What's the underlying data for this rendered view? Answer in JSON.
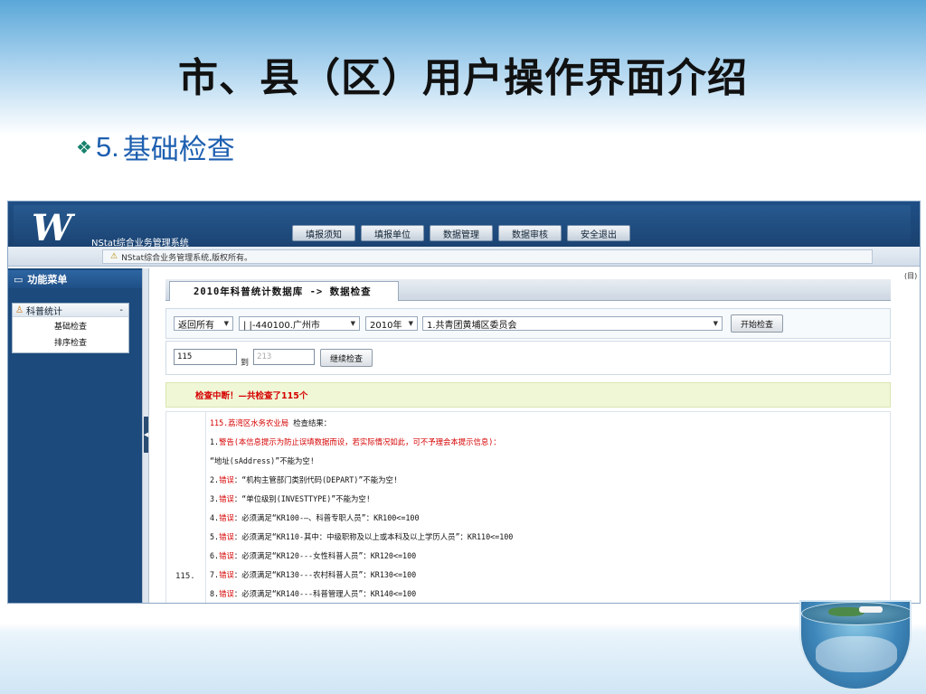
{
  "slide": {
    "title": "市、县（区）用户操作界面介绍",
    "bullet_number": "5.",
    "bullet_text": "基础检查"
  },
  "app": {
    "logo": "W",
    "system_name": "NStat综合业务管理系统",
    "nav": [
      "填报须知",
      "填报单位",
      "数据管理",
      "数据审核",
      "安全退出"
    ],
    "notice": "NStat综合业务管理系统,版权所有。"
  },
  "sidebar": {
    "header": "功能菜单",
    "group_label": "科普统计",
    "group_toggle": "-",
    "items": [
      "基础检查",
      "排序检查"
    ]
  },
  "main": {
    "breadcrumb": "2010年科普统计数据库 -> 数据检查",
    "filters": {
      "return": "返回所有",
      "region": "| |-440100.广州市",
      "year": "2010年",
      "unit": "1.共青团黄埔区委员会"
    },
    "start_button": "开始检查",
    "range_from": "115",
    "to_label": "到",
    "range_to_placeholder": "213",
    "continue_button": "继续检查",
    "alert": "检查中断！—共检查了115个",
    "row_number": "115.",
    "result_title_unit": "115.荔湾区水务农业局",
    "result_title_suffix": "检查结果：",
    "warning_prefix": "1.",
    "warning_label": "警告",
    "warning_text": "(本信息提示为防止误填数据而设，若实际情况如此，可不予理会本提示信息)：",
    "warning_detail": "“地址(sAddress)”不能为空!",
    "error_label": "错误",
    "errors": [
      {
        "num": "2.",
        "text": "：“机构主管部门类别代码(DEPART)”不能为空!"
      },
      {
        "num": "3.",
        "text": "：“单位级别(INVESTTYPE)”不能为空!"
      },
      {
        "num": "4.",
        "text": "：必须满足“KR100-—、科普专职人员”：KR100<=100"
      },
      {
        "num": "5.",
        "text": "：必须满足“KR110-其中：中级职称及以上或本科及以上学历人员”：KR110<=100"
      },
      {
        "num": "6.",
        "text": "：必须满足“KR120---女性科普人员”：KR120<=100"
      },
      {
        "num": "7.",
        "text": "：必须满足“KR130---农村科普人员”：KR130<=100"
      },
      {
        "num": "8.",
        "text": "：必须满足“KR140---科普管理人员”：KR140<=100"
      }
    ]
  },
  "right_edge_label": "(目)",
  "icons": [
    "diamond-bullet-icon",
    "monitor-icon",
    "person-icon",
    "warning-icon",
    "dropdown-arrow-icon",
    "collapse-grip-icon",
    "globe-bowl-icon"
  ]
}
